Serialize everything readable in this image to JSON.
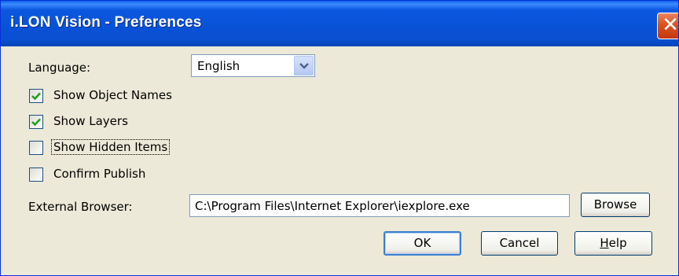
{
  "window": {
    "title": "i.LON Vision - Preferences",
    "close_glyph": "✕"
  },
  "language": {
    "label": "Language:",
    "value": "English"
  },
  "options": [
    {
      "label": "Show Object Names",
      "checked": true
    },
    {
      "label": "Show Layers",
      "checked": true
    },
    {
      "label": "Show Hidden Items",
      "checked": false
    },
    {
      "label": "Confirm Publish",
      "checked": false
    }
  ],
  "external_browser": {
    "label": "External Browser:",
    "value": "C:\\Program Files\\Internet Explorer\\iexplore.exe"
  },
  "buttons": {
    "browse": "Browse",
    "ok": "OK",
    "cancel": "Cancel",
    "help_mnemonic": "H",
    "help_rest": "elp"
  },
  "colors": {
    "titlebar": "#0852d6",
    "dialog_bg": "#ece9d8",
    "check": "#21a121",
    "close": "#d9541e"
  },
  "icons": {
    "close": "close-icon",
    "dropdown": "chevron-down-icon",
    "check": "checkmark-icon"
  }
}
